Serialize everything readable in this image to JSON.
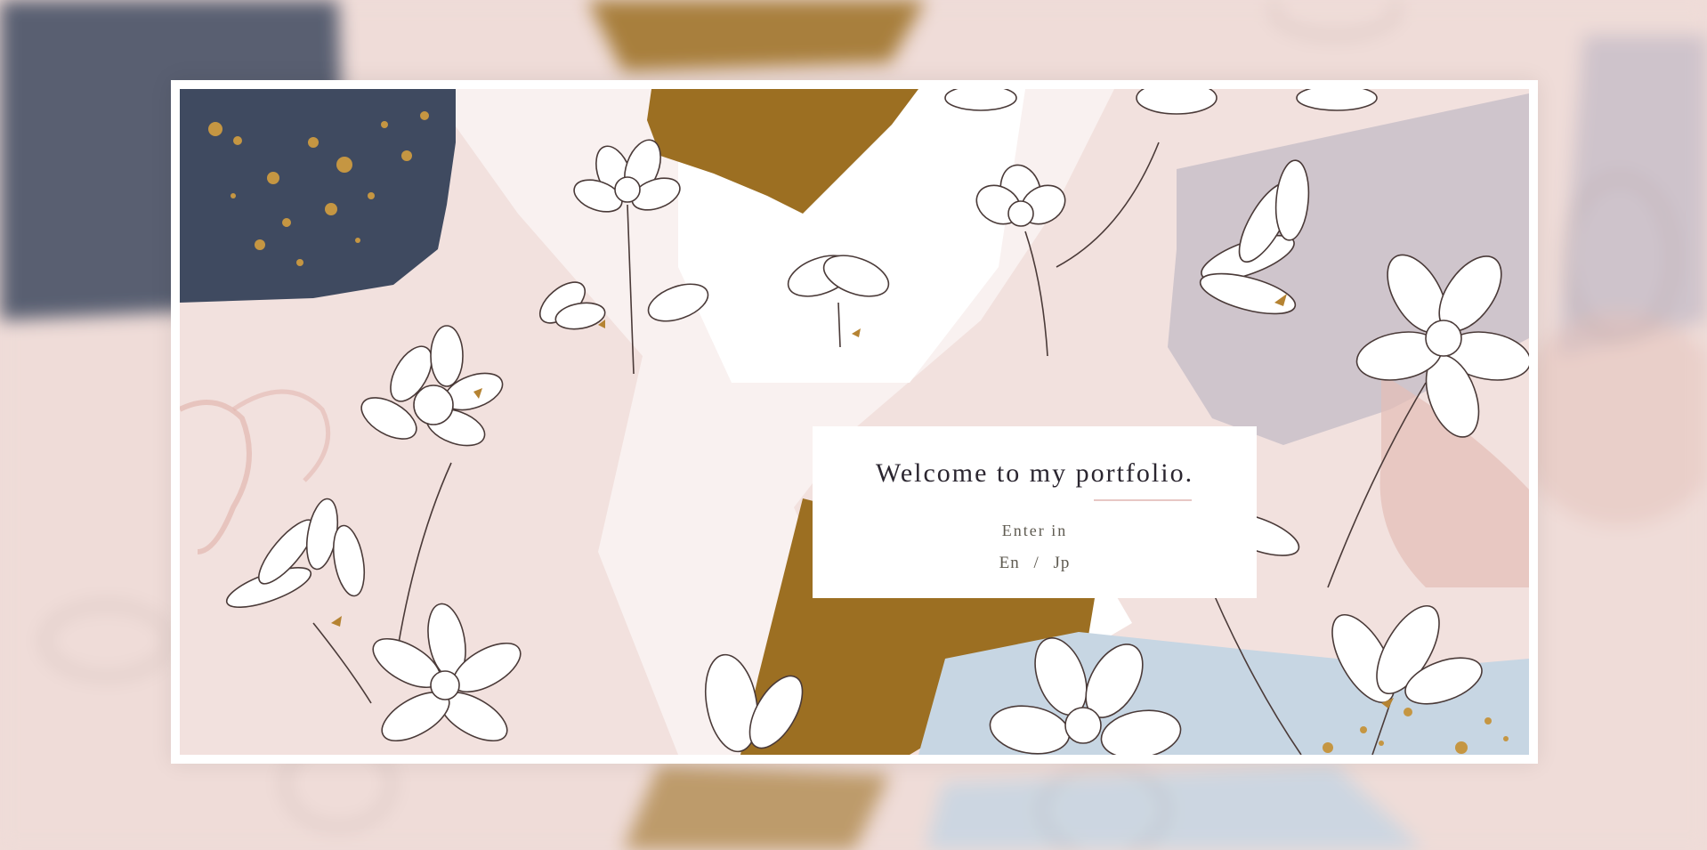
{
  "welcome": {
    "title": "Welcome to my portfolio.",
    "enter_label": "Enter in",
    "languages": [
      "En",
      "Jp"
    ],
    "separator": "/"
  },
  "colors": {
    "blush": "#f2e1de",
    "navy": "#3f4a60",
    "gold": "#9c6f22",
    "lavender": "#c9bfc9",
    "sky": "#c7d6e3",
    "ink": "#4a3a38"
  },
  "decor": {
    "icons": [
      "flower-icon",
      "gold-splatter-icon",
      "brush-stroke-icon"
    ]
  }
}
